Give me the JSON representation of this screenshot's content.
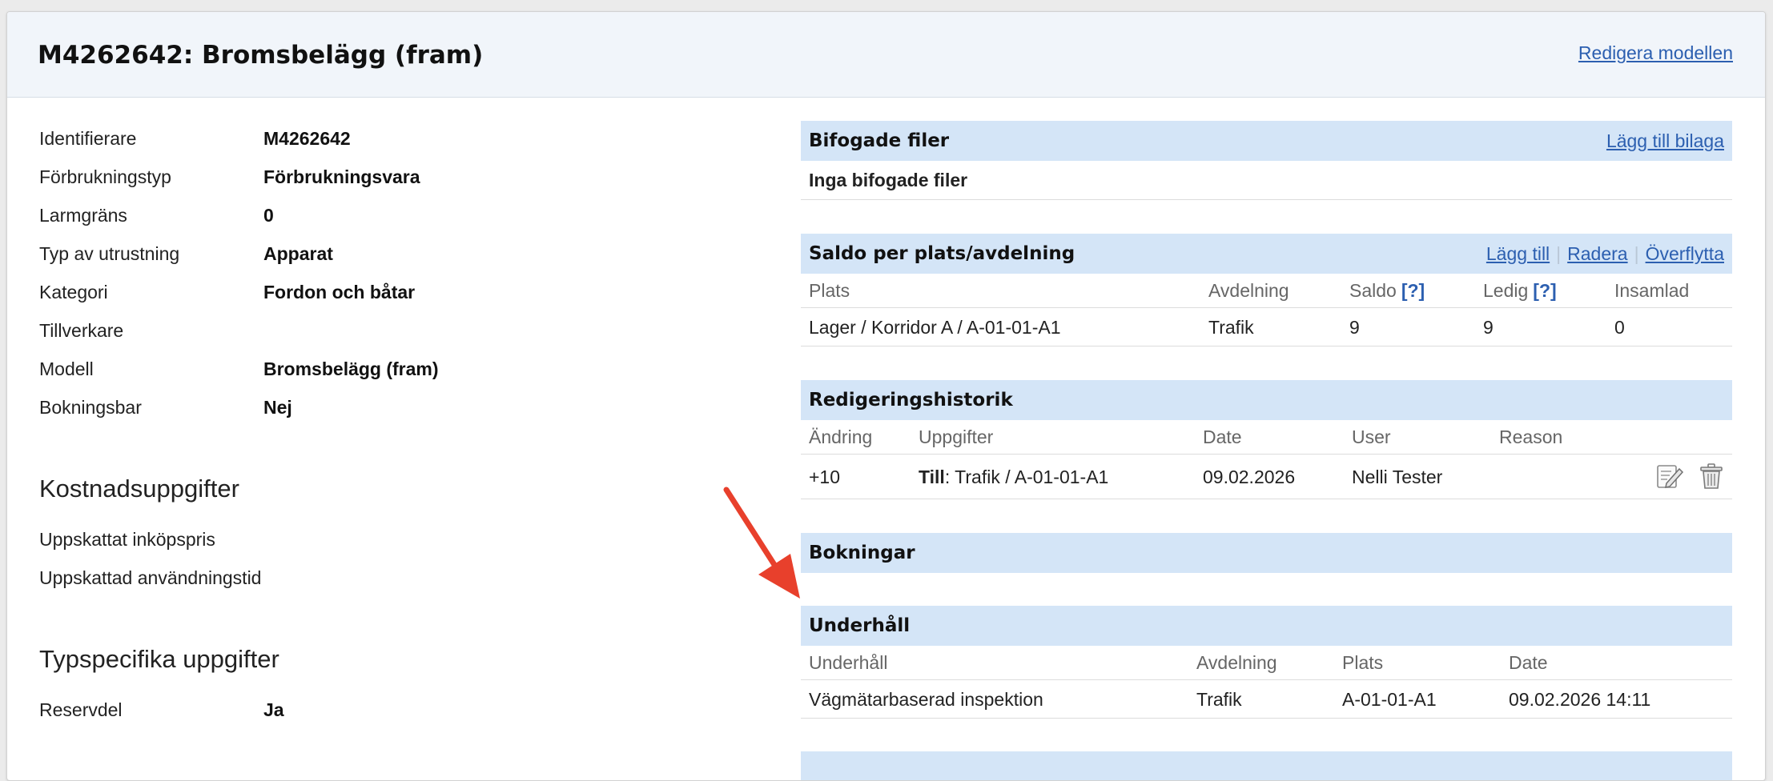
{
  "header": {
    "title": "M4262642: Bromsbelägg (fram)",
    "edit_link": "Redigera modellen"
  },
  "attributes": [
    {
      "label": "Identifierare",
      "value": "M4262642"
    },
    {
      "label": "Förbrukningstyp",
      "value": "Förbrukningsvara"
    },
    {
      "label": "Larmgräns",
      "value": "0"
    },
    {
      "label": "Typ av utrustning",
      "value": "Apparat"
    },
    {
      "label": "Kategori",
      "value": "Fordon och båtar"
    },
    {
      "label": "Tillverkare",
      "value": ""
    },
    {
      "label": "Modell",
      "value": "Bromsbelägg (fram)"
    },
    {
      "label": "Bokningsbar",
      "value": "Nej"
    }
  ],
  "cost": {
    "heading": "Kostnadsuppgifter",
    "rows": [
      {
        "label": "Uppskattat inköpspris",
        "value": ""
      },
      {
        "label": "Uppskattad användningstid",
        "value": ""
      }
    ]
  },
  "type_specific": {
    "heading": "Typspecifika uppgifter",
    "rows": [
      {
        "label": "Reservdel",
        "value": "Ja"
      }
    ]
  },
  "attachments": {
    "title": "Bifogade filer",
    "add_link": "Lägg till bilaga",
    "empty_text": "Inga bifogade filer"
  },
  "balance": {
    "title": "Saldo per plats/avdelning",
    "actions": [
      "Lägg till",
      "Radera",
      "Överflytta"
    ],
    "columns": [
      "Plats",
      "Avdelning",
      "Saldo",
      "Ledig",
      "Insamlad"
    ],
    "help_marker": "[?]",
    "rows": [
      [
        "Lager / Korridor A / A-01-01-A1",
        "Trafik",
        "9",
        "9",
        "0"
      ]
    ]
  },
  "history": {
    "title": "Redigeringshistorik",
    "columns": [
      "Ändring",
      "Uppgifter",
      "Date",
      "User",
      "Reason"
    ],
    "rows": [
      {
        "change": "+10",
        "details_bold": "Till",
        "details_rest": ": Trafik / A-01-01-A1",
        "date": "09.02.2026",
        "user": "Nelli Tester",
        "reason": ""
      }
    ]
  },
  "bookings": {
    "title": "Bokningar"
  },
  "maintenance": {
    "title": "Underhåll",
    "columns": [
      "Underhåll",
      "Avdelning",
      "Plats",
      "Date"
    ],
    "rows": [
      [
        "Vägmätarbaserad inspektion",
        "Trafik",
        "A-01-01-A1",
        "09.02.2026 14:11"
      ]
    ]
  },
  "colors": {
    "accent": "#2c5fb0",
    "box_header": "#d4e5f7",
    "arrow": "#e8402c"
  }
}
